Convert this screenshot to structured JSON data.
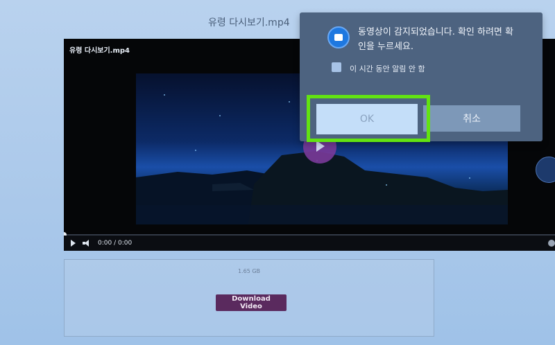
{
  "page": {
    "title": "유령 다시보기.mp4"
  },
  "player": {
    "title": "유령 다시보기.mp4",
    "time": "0:00 / 0:00",
    "progress": 0
  },
  "download": {
    "size": "1.65 GB",
    "button_label": "Download Video"
  },
  "dialog": {
    "message": "동영상이 감지되었습니다. 확인 하려면 확인을 누르세요.",
    "checkbox_label": "이 시간 동안 알림 안 함",
    "ok_label": "OK",
    "cancel_label": "취소"
  },
  "colors": {
    "highlight": "#62e312",
    "download_button": "#5a2a5e",
    "dialog_background": "#4d6380"
  },
  "icons": [
    "video-camera-icon",
    "play-icon",
    "volume-icon",
    "settings-icon"
  ]
}
